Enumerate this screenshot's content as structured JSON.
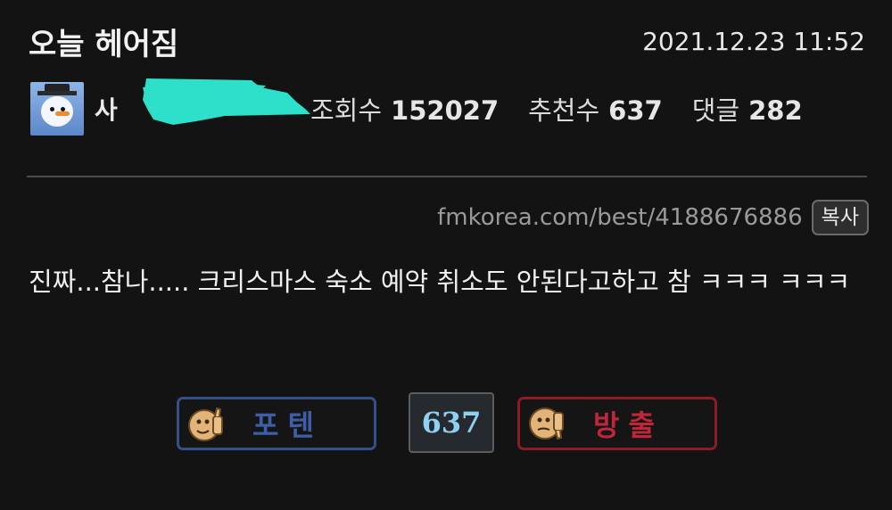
{
  "post": {
    "title": "오늘 헤어짐",
    "datetime": "2021.12.23 11:52",
    "author": "사",
    "stats": {
      "views_label": "조회수",
      "views": "152027",
      "recommend_label": "추천수",
      "recommend": "637",
      "comments_label": "댓글",
      "comments": "282"
    },
    "url": "fmkorea.com/best/4188676886",
    "copy_label": "복사",
    "content": "진짜...참나..... 크리스마스 숙소 예약 취소도 안된다고하고 참 ㅋㅋㅋ ㅋㅋㅋ"
  },
  "vote": {
    "up_label": "포텐",
    "count": "637",
    "down_label": "방출"
  },
  "colors": {
    "background": "#131313",
    "redaction": "#2de0c9",
    "vote_up": "#344f8a",
    "vote_down": "#8c1c26",
    "vote_count": "#8fd0f5"
  },
  "icons": {
    "avatar": "snowman-avatar",
    "vote_up": "thumbs-up-icon",
    "vote_down": "thumbs-down-icon"
  }
}
